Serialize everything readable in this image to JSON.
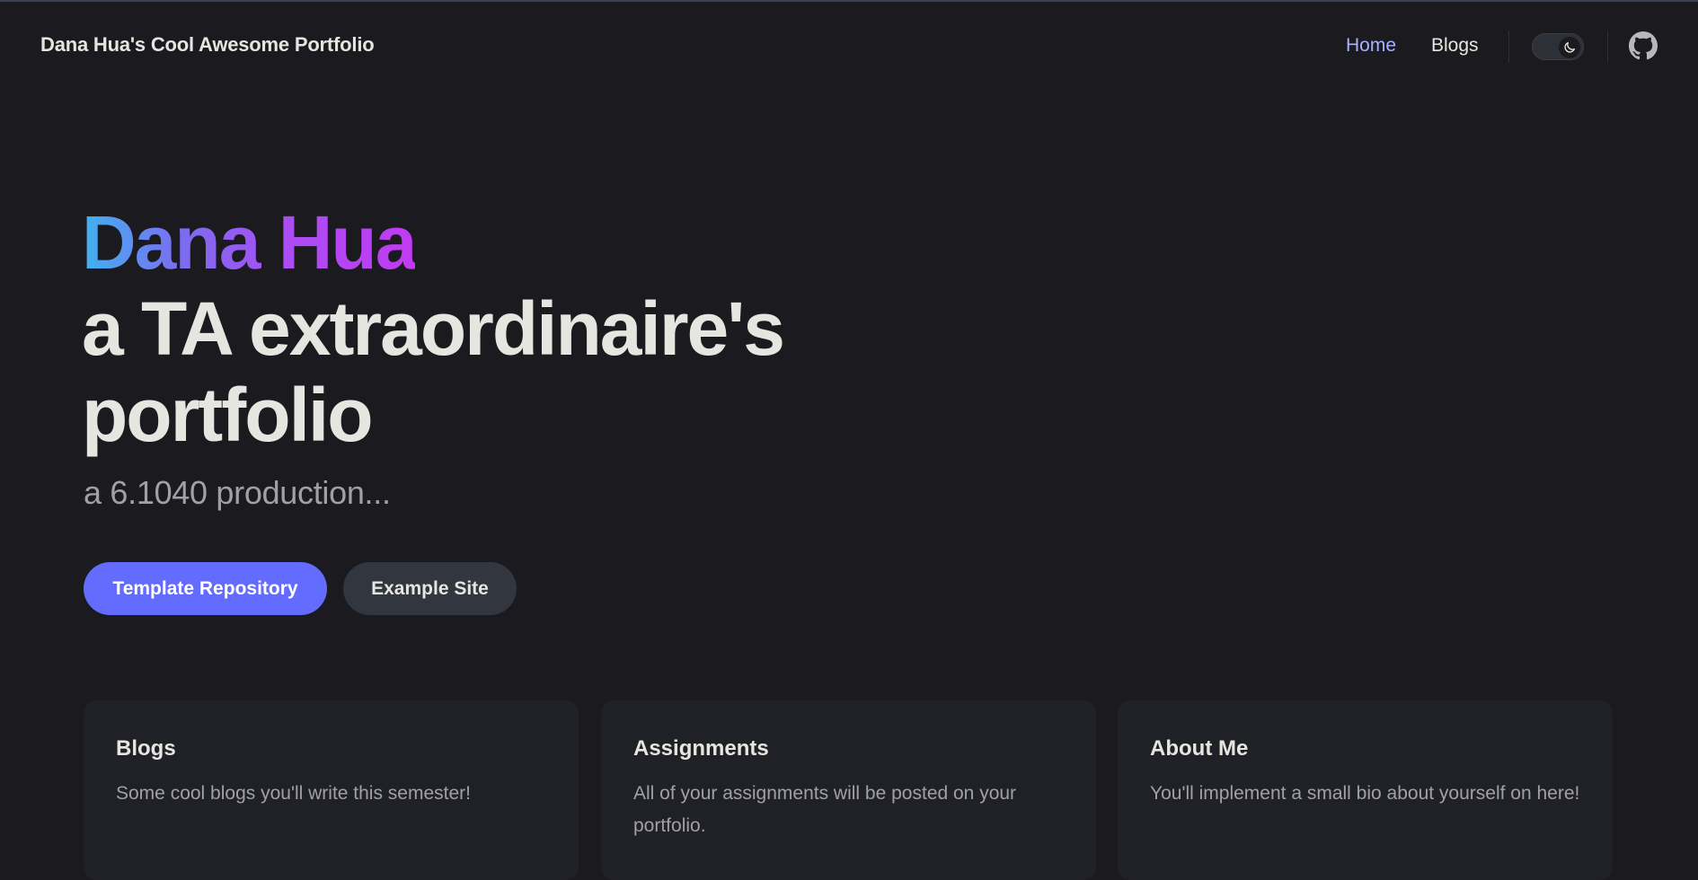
{
  "header": {
    "site_title": "Dana Hua's Cool Awesome Portfolio",
    "nav": [
      {
        "label": "Home",
        "active": true
      },
      {
        "label": "Blogs",
        "active": false
      }
    ],
    "theme_toggle_icon": "moon-icon",
    "github_icon": "github-icon"
  },
  "hero": {
    "name": "Dana Hua",
    "tagline": "a TA extraordinaire's portfolio",
    "subtitle": "a 6.1040 production...",
    "buttons": {
      "primary_label": "Template Repository",
      "secondary_label": "Example Site"
    }
  },
  "cards": [
    {
      "title": "Blogs",
      "description": "Some cool blogs you'll write this semester!"
    },
    {
      "title": "Assignments",
      "description": "All of your assignments will be posted on your portfolio."
    },
    {
      "title": "About Me",
      "description": "You'll implement a small bio about yourself on here!"
    }
  ],
  "colors": {
    "background": "#1b1b1f",
    "accent": "#646cff",
    "active_link": "#a8b1ff",
    "text": "#e6e6e0",
    "muted_text": "#a0a0a6"
  }
}
